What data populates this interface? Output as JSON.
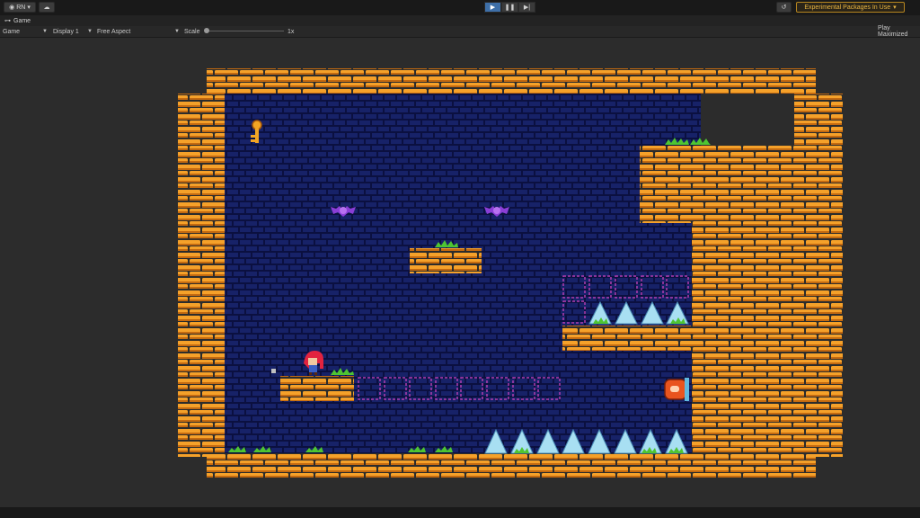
{
  "toolbar": {
    "account_label": "RN",
    "play_controls": [
      "play",
      "pause",
      "step"
    ],
    "experimental_label": "Experimental Packages In Use"
  },
  "tab": {
    "label": "Game"
  },
  "controls": {
    "view_mode": "Game",
    "display": "Display 1",
    "aspect": "Free Aspect",
    "scale_label": "Scale",
    "scale_value": "1x",
    "play_mode": "Play Maximized"
  },
  "colors": {
    "editor_bg": "#2c2c2c",
    "brick": "#f5a12a",
    "brick_shadow": "#c46a10",
    "background_brick": "#172268",
    "background_mortar": "#0b1040",
    "grass": "#4ec532",
    "spike": "#a8dff2",
    "ghost_block": "#b13cb0",
    "bat": "#8a3ed6",
    "hero_hair": "#e2233f",
    "key": "#f2a524",
    "cannon": "#e9541e"
  },
  "sprites": {
    "key": "key-icon",
    "bats": 2,
    "hero": "player-character",
    "cannon": "cannon-icon"
  }
}
